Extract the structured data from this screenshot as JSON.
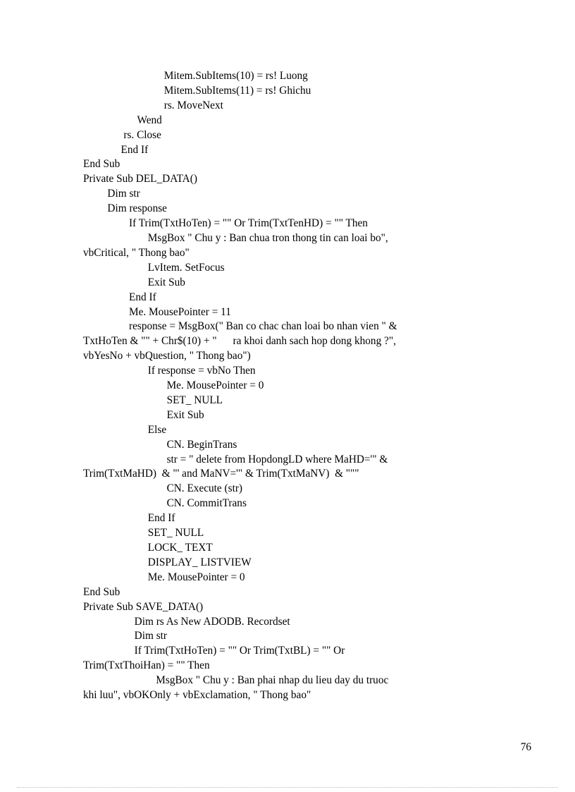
{
  "document": {
    "page_number": "76",
    "code_lines": [
      "                              Mitem.SubItems(10) = rs! Luong",
      "                              Mitem.SubItems(11) = rs! Ghichu",
      "                              rs. MoveNext",
      "                    Wend",
      "               rs. Close",
      "              End If",
      "End Sub",
      "Private Sub DEL_DATA()",
      "         Dim str",
      "         Dim response",
      "                 If Trim(TxtHoTen) = \"\" Or Trim(TxtTenHD) = \"\" Then",
      "                        MsgBox \" Chu y : Ban chua tron thong tin can loai bo\",",
      "vbCritical, \" Thong bao\"",
      "                        LvItem. SetFocus",
      "                        Exit Sub",
      "                 End If",
      "                 Me. MousePointer = 11",
      "                 response = MsgBox(\" Ban co chac chan loai bo nhan vien \" &",
      "TxtHoTen & \"\" + Chr$(10) + \"      ra khoi danh sach hop dong khong ?\",",
      "vbYesNo + vbQuestion, \" Thong bao\")",
      "                        If response = vbNo Then",
      "                               Me. MousePointer = 0",
      "                               SET_ NULL",
      "                               Exit Sub",
      "                        Else",
      "                               CN. BeginTrans",
      "                               str = \" delete from HopdongLD where MaHD='\" &",
      "Trim(TxtMaHD)  & \"' and MaNV='\" & Trim(TxtMaNV)  & \"\"\"",
      "                               CN. Execute (str)",
      "                               CN. CommitTrans",
      "                        End If",
      "                        SET_ NULL",
      "                        LOCK_ TEXT",
      "                        DISPLAY_ LISTVIEW",
      "                        Me. MousePointer = 0",
      "End Sub",
      "Private Sub SAVE_DATA()",
      "                   Dim rs As New ADODB. Recordset",
      "                   Dim str",
      "                   If Trim(TxtHoTen) = \"\" Or Trim(TxtBL) = \"\" Or",
      "Trim(TxtThoiHan) = \"\" Then",
      "                           MsgBox \" Chu y : Ban phai nhap du lieu day du truoc",
      "khi luu\", vbOKOnly + vbExclamation, \" Thong bao\""
    ]
  }
}
